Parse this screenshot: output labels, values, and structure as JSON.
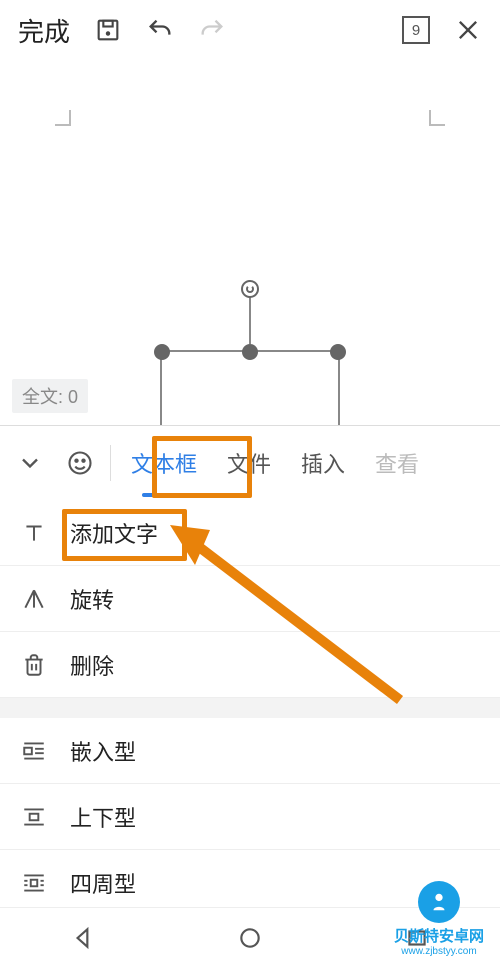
{
  "topbar": {
    "done": "完成",
    "page_count": "9"
  },
  "canvas": {
    "wordcount_label": "全文: 0"
  },
  "tabs": {
    "textbox": "文本框",
    "file": "文件",
    "insert": "插入",
    "view": "查看"
  },
  "options": {
    "add_text": "添加文字",
    "rotate": "旋转",
    "delete": "删除",
    "wrap_inline": "嵌入型",
    "wrap_topbottom": "上下型",
    "wrap_square": "四周型"
  },
  "watermark": {
    "line1": "贝斯特安卓网",
    "line2": "www.zjbstyy.com"
  }
}
